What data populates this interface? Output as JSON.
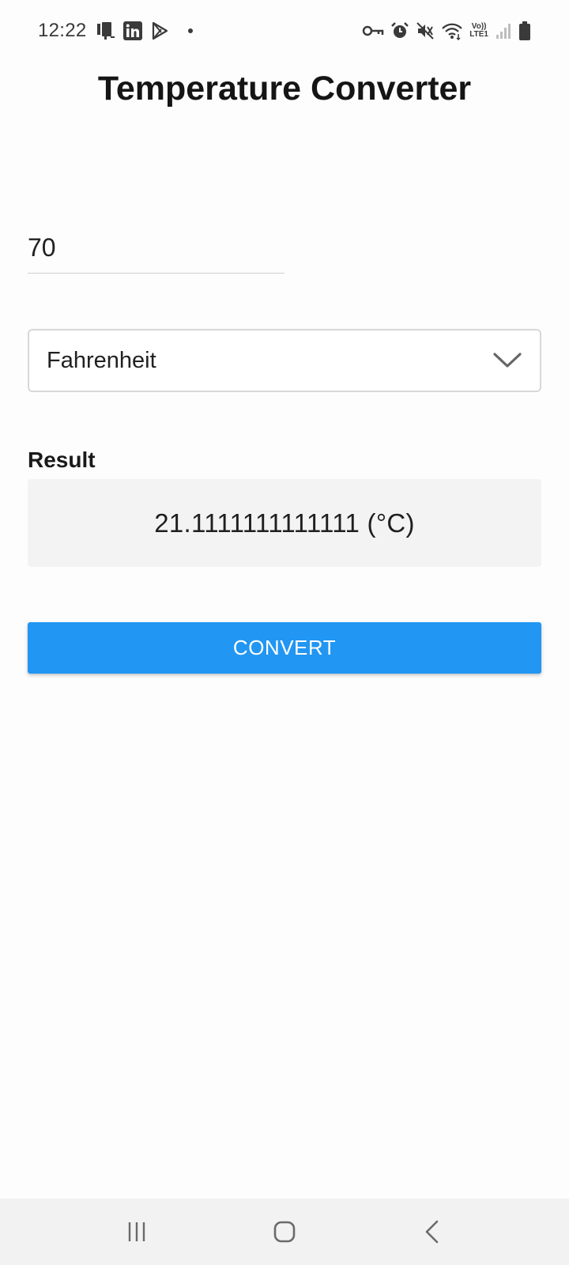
{
  "status_bar": {
    "time": "12:22",
    "left_icons": [
      "sim-card-icon",
      "linkedin-icon",
      "play-store-icon",
      "notification-dot-icon"
    ],
    "right_icons": [
      "vpn-key-icon",
      "alarm-icon",
      "mute-icon",
      "wifi-icon",
      "volte-lte-icon",
      "signal-icon",
      "battery-icon"
    ],
    "network_label_top": "Vo))",
    "network_label_bottom": "LTE1"
  },
  "app": {
    "title": "Temperature Converter"
  },
  "input": {
    "value": "70"
  },
  "unit_select": {
    "selected": "Fahrenheit"
  },
  "result": {
    "heading": "Result",
    "value": "21.1111111111111 (°C)"
  },
  "convert_button": {
    "label": "CONVERT"
  },
  "nav_bar": {
    "items": [
      "recent-apps-icon",
      "home-icon",
      "back-icon"
    ]
  },
  "colors": {
    "accent": "#2196f3",
    "result_bg": "#f3f3f3",
    "nav_bg": "#f2f2f2"
  }
}
